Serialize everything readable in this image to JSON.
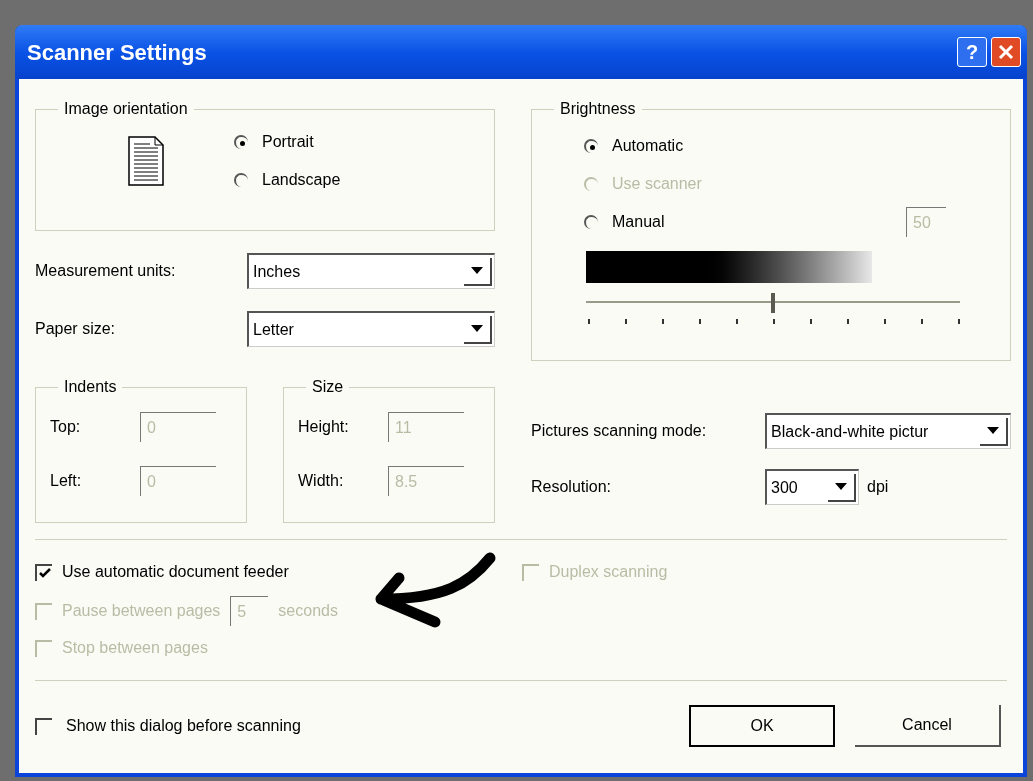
{
  "window": {
    "title": "Scanner Settings",
    "help_button": "?"
  },
  "orientation": {
    "label": "Image orientation",
    "options": [
      {
        "label": "Portrait",
        "selected": true
      },
      {
        "label": "Landscape",
        "selected": false
      }
    ]
  },
  "measurement_units": {
    "label": "Measurement units:",
    "value": "Inches"
  },
  "paper_size": {
    "label": "Paper size:",
    "value": "Letter"
  },
  "indents": {
    "label": "Indents",
    "fields": [
      {
        "label": "Top:",
        "value": "0",
        "disabled": true
      },
      {
        "label": "Left:",
        "value": "0",
        "disabled": true
      }
    ]
  },
  "size": {
    "label": "Size",
    "fields": [
      {
        "label": "Height:",
        "value": "11",
        "disabled": true
      },
      {
        "label": "Width:",
        "value": "8.5",
        "disabled": true
      }
    ]
  },
  "brightness": {
    "label": "Brightness",
    "options": [
      {
        "label": "Automatic",
        "selected": true,
        "disabled": false
      },
      {
        "label": "Use scanner",
        "selected": false,
        "disabled": true
      },
      {
        "label": "Manual",
        "selected": false,
        "disabled": false
      }
    ],
    "value": "50",
    "value_disabled": true,
    "level": 0.5
  },
  "pictures_scanning_mode": {
    "label": "Pictures scanning mode:",
    "value": "Black-and-white pictur"
  },
  "resolution": {
    "label": "Resolution:",
    "value": "300",
    "unit": "dpi"
  },
  "feeder": {
    "label": "Use automatic document feeder",
    "checked": true,
    "disabled": false
  },
  "duplex": {
    "label": "Duplex scanning",
    "checked": false,
    "disabled": true
  },
  "pause": {
    "label": "Pause between pages",
    "checked": false,
    "disabled": true,
    "value": "5",
    "unit": "seconds"
  },
  "stop": {
    "label": "Stop between pages",
    "checked": false,
    "disabled": true
  },
  "show_dialog": {
    "label": "Show this dialog before scanning",
    "checked": false,
    "disabled": false
  },
  "buttons": [
    {
      "label": "OK",
      "default": true
    },
    {
      "label": "Cancel",
      "default": false
    }
  ]
}
